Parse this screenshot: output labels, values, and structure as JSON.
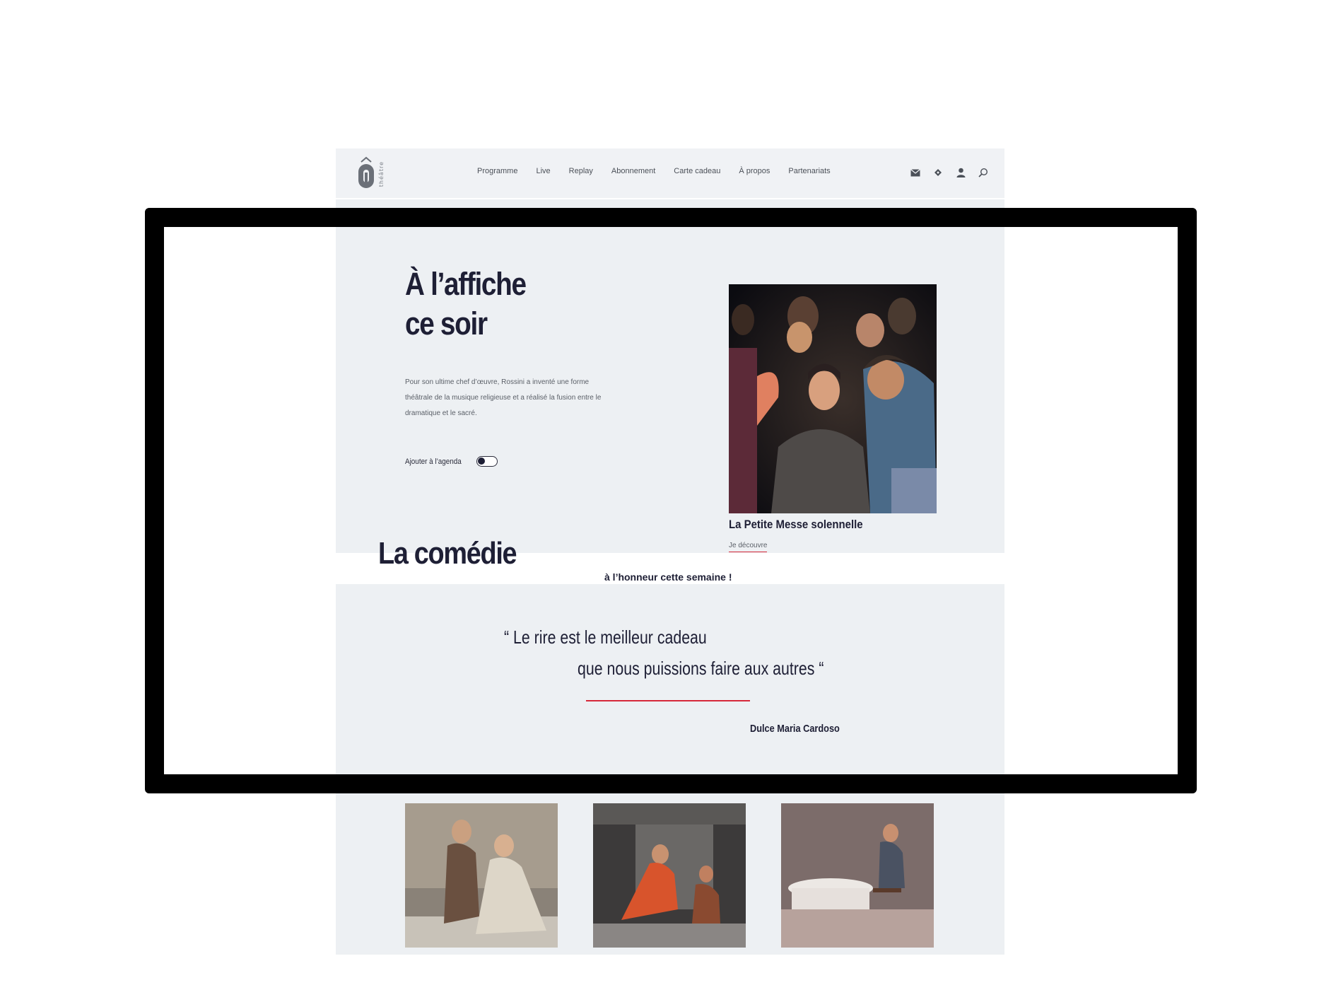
{
  "header": {
    "logo_word": "théâtre",
    "menu": [
      "Programme",
      "Live",
      "Replay",
      "Abonnement",
      "Carte cadeau",
      "À propos",
      "Partenariats"
    ],
    "icons": [
      "mail-icon",
      "ticket-icon",
      "user-icon",
      "search-icon"
    ]
  },
  "hero": {
    "title_line1": "À l’affiche",
    "title_line2": "ce soir",
    "description": "Pour son ultime chef d’œuvre, Rossini a inventé une forme théâtrale de la musique religieuse et a réalisé la fusion entre le dramatique et le sacré.",
    "agenda_label": "Ajouter à l’agenda",
    "agenda_enabled": false
  },
  "featured": {
    "title": "La Petite Messe solennelle",
    "link_label": "Je découvre"
  },
  "comedie": {
    "title": "La comédie",
    "subtitle": "à l’honneur cette semaine !"
  },
  "quote": {
    "line1": "“ Le rire est le meilleur cadeau",
    "line2": "que nous puissions faire aux autres “",
    "author": "Dulce Maria Cardoso"
  },
  "colors": {
    "accent": "#d62839",
    "text": "#1e1f35",
    "panel": "#edf0f3"
  }
}
